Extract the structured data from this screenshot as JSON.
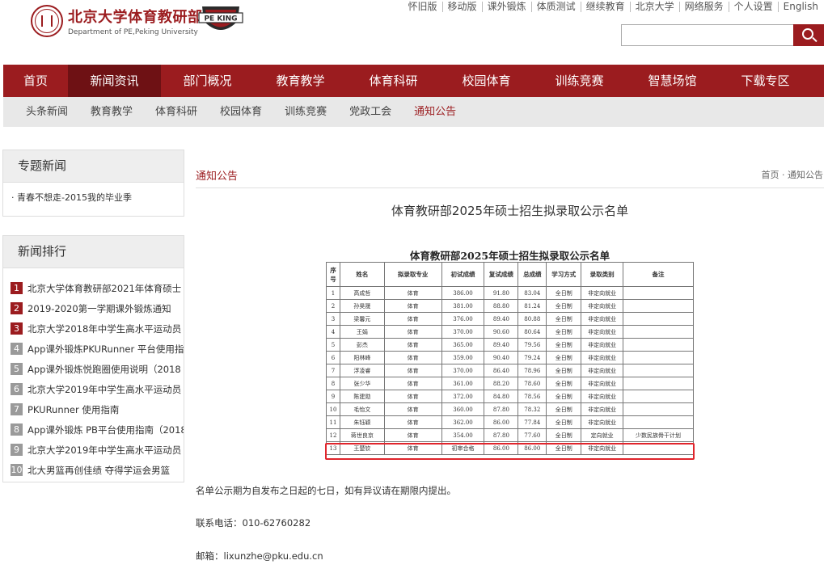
{
  "header": {
    "logo_cn": "北京大学体育教研部",
    "logo_en": "Department of PE,Peking University",
    "peking_badge": "PE KING",
    "top_links": [
      "怀旧版",
      "移动版",
      "课外锻炼",
      "体质测试",
      "继续教育",
      "北京大学",
      "网络服务",
      "个人设置",
      "English"
    ],
    "search_placeholder": ""
  },
  "main_nav": [
    "首页",
    "新闻资讯",
    "部门概况",
    "教育教学",
    "体育科研",
    "校园体育",
    "训练竞赛",
    "智慧场馆",
    "下载专区"
  ],
  "main_nav_active": 1,
  "sub_nav": [
    "头条新闻",
    "教育教学",
    "体育科研",
    "校园体育",
    "训练竞赛",
    "党政工会",
    "通知公告"
  ],
  "sub_nav_active": 6,
  "sidebar": {
    "topics_title": "专题新闻",
    "topics": [
      "· 青春不想走-2015我的毕业季"
    ],
    "ranking_title": "新闻排行",
    "ranking": [
      {
        "num": "1",
        "text": "北京大学体育教研部2021年体育硕士"
      },
      {
        "num": "2",
        "text": "2019-2020第一学期课外锻炼通知"
      },
      {
        "num": "3",
        "text": "北京大学2018年中学生高水平运动员"
      },
      {
        "num": "4",
        "text": "App课外锻炼PKURunner 平台使用指"
      },
      {
        "num": "5",
        "text": "App课外锻炼悦跑圈使用说明（2018"
      },
      {
        "num": "6",
        "text": "北京大学2019年中学生高水平运动员"
      },
      {
        "num": "7",
        "text": "PKURunner 使用指南"
      },
      {
        "num": "8",
        "text": "App课外锻炼 PB平台使用指南（2018"
      },
      {
        "num": "9",
        "text": "北京大学2019年中学生高水平运动员"
      },
      {
        "num": "10",
        "text": "北大男篮再创佳绩 夺得学运会男篮"
      }
    ]
  },
  "content": {
    "section_title": "通知公告",
    "breadcrumb": "首页 · 通知公告",
    "article_title": "体育教研部2025年硕士招生拟录取公示名单",
    "table_title": "体育教研部2025年硕士招生拟录取公示名单",
    "table_headers": [
      "序号",
      "姓名",
      "拟录取专业",
      "初试成绩",
      "复试成绩",
      "总成绩",
      "学习方式",
      "录取类别",
      "备注"
    ],
    "table_rows": [
      [
        "1",
        "高成哲",
        "体育",
        "386.00",
        "91.80",
        "83.04",
        "全日制",
        "非定向就业",
        ""
      ],
      [
        "2",
        "孙昊晟",
        "体育",
        "381.00",
        "88.80",
        "81.24",
        "全日制",
        "非定向就业",
        ""
      ],
      [
        "3",
        "梁馨元",
        "体育",
        "376.00",
        "89.40",
        "80.88",
        "全日制",
        "非定向就业",
        ""
      ],
      [
        "4",
        "王娟",
        "体育",
        "370.00",
        "90.60",
        "80.64",
        "全日制",
        "非定向就业",
        ""
      ],
      [
        "5",
        "彭杰",
        "体育",
        "365.00",
        "89.40",
        "79.56",
        "全日制",
        "非定向就业",
        ""
      ],
      [
        "6",
        "阳林峰",
        "体育",
        "359.00",
        "90.40",
        "79.24",
        "全日制",
        "非定向就业",
        ""
      ],
      [
        "7",
        "浮凌睿",
        "体育",
        "370.00",
        "86.40",
        "78.96",
        "全日制",
        "非定向就业",
        ""
      ],
      [
        "8",
        "张少华",
        "体育",
        "361.00",
        "88.20",
        "78.60",
        "全日制",
        "非定向就业",
        ""
      ],
      [
        "9",
        "陈建勋",
        "体育",
        "372.00",
        "84.80",
        "78.56",
        "全日制",
        "非定向就业",
        ""
      ],
      [
        "10",
        "毛怡文",
        "体育",
        "360.00",
        "87.80",
        "78.32",
        "全日制",
        "非定向就业",
        ""
      ],
      [
        "11",
        "朱钰颖",
        "体育",
        "362.00",
        "86.00",
        "77.84",
        "全日制",
        "非定向就业",
        ""
      ],
      [
        "12",
        "蒋世良京",
        "体育",
        "354.00",
        "87.80",
        "77.60",
        "全日制",
        "定向就业",
        "少数民族骨干计划"
      ],
      [
        "13",
        "王楚钦",
        "体育",
        "初审合格",
        "86.00",
        "86.00",
        "全日制",
        "非定向就业",
        ""
      ]
    ],
    "notice": "名单公示期为自发布之日起的七日，如有异议请在期限内提出。",
    "phone": "联系电话：010-62760282",
    "email": "邮箱：lixunzhe@pku.edu.cn"
  }
}
